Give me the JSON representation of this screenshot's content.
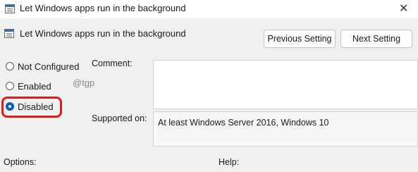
{
  "window": {
    "title": "Let Windows apps run in the background",
    "close_glyph": "✕"
  },
  "header": {
    "policy_name": "Let Windows apps run in the background",
    "previous_label": "Previous Setting",
    "next_label": "Next Setting"
  },
  "state": {
    "options": [
      {
        "label": "Not Configured",
        "checked": false
      },
      {
        "label": "Enabled",
        "checked": false
      },
      {
        "label": "Disabled",
        "checked": true
      }
    ],
    "highlight_color": "#e01b1b"
  },
  "watermark": "@tgp",
  "comment": {
    "label": "Comment:",
    "value": ""
  },
  "supported_on": {
    "label": "Supported on:",
    "value": "At least Windows Server 2016, Windows 10"
  },
  "sections": {
    "options_label": "Options:",
    "help_label": "Help:"
  },
  "icons": {
    "window": "policy-window-icon",
    "header": "policy-setting-icon",
    "close": "close-icon"
  },
  "colors": {
    "accent": "#0a5eb5",
    "background": "#f0f0f0"
  }
}
